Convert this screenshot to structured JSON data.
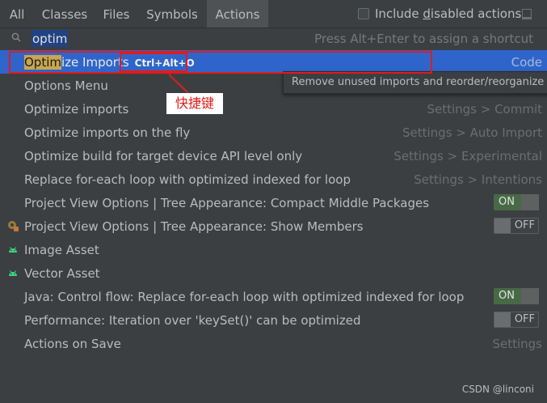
{
  "tabs": [
    {
      "label": "All"
    },
    {
      "label": "Classes"
    },
    {
      "label": "Files"
    },
    {
      "label": "Symbols"
    },
    {
      "label": "Actions",
      "active": true
    }
  ],
  "include_disabled": {
    "prefix": "Include ",
    "mnemonic": "d",
    "suffix": "isabled actions",
    "checked": false
  },
  "search": {
    "query": "optim",
    "hint": "Press Alt+Enter to assign a shortcut"
  },
  "results": [
    {
      "label_highlight": "Optim",
      "label_rest": "ize Imports",
      "shortcut": "Ctrl+Alt+O",
      "category": "Code",
      "selected": true
    },
    {
      "label": "Options Menu",
      "category": ""
    },
    {
      "label": "Optimize imports",
      "category": "Settings > Commit"
    },
    {
      "label": "Optimize imports on the fly",
      "category": "Settings > Auto Import"
    },
    {
      "label": "Optimize build for target device API level only",
      "category": "Settings > Experimental"
    },
    {
      "label": "Replace for-each loop with optimized indexed for loop",
      "category": "Settings > Intentions"
    },
    {
      "label": "Project View Options | Tree Appearance: Compact Middle Packages",
      "toggle": "ON"
    },
    {
      "label": "Project View Options | Tree Appearance: Show Members",
      "toggle": "OFF",
      "icon": "members-icon"
    },
    {
      "label": "Image Asset",
      "icon": "android-icon"
    },
    {
      "label": "Vector Asset",
      "icon": "android-icon"
    },
    {
      "label": "Java: Control flow: Replace for-each loop with optimized indexed for loop",
      "toggle": "ON"
    },
    {
      "label": "Performance: Iteration over 'keySet()' can be optimized",
      "toggle": "OFF"
    },
    {
      "label": "Actions on Save",
      "category": "Settings"
    }
  ],
  "tooltip": "Remove unused imports and reorder/reorganize imports",
  "annotation": {
    "label": "快捷键",
    "color": "#e21b1b"
  },
  "watermark": "CSDN @linconi",
  "colors": {
    "background": "#3c3f41",
    "selection": "#2f65ca",
    "match_highlight": "#c9a64f",
    "toggle_on": "#486946"
  }
}
